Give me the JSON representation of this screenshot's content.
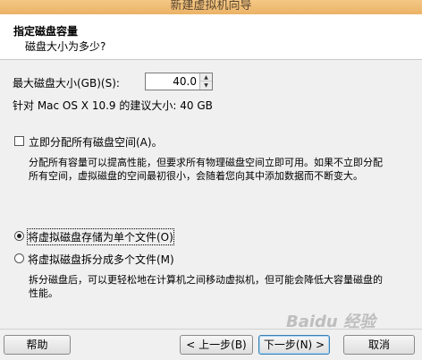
{
  "window": {
    "title": "新建虚拟机向导"
  },
  "header": {
    "title": "指定磁盘容量",
    "subtitle": "磁盘大小为多少?"
  },
  "disk_size": {
    "label": "最大磁盘大小(GB)(S):",
    "value": "40.0",
    "recommendation": "针对 Mac OS X 10.9 的建议大小: 40 GB"
  },
  "allocate": {
    "checked": false,
    "label": "立即分配所有磁盘空间(A)。",
    "description_line1": "分配所有容量可以提高性能，但要求所有物理磁盘空间立即可用。如果不立即分配",
    "description_line2": "所有空间，虚拟磁盘的空间最初很小，会随着您向其中添加数据而不断变大。"
  },
  "storage_options": {
    "single": {
      "label": "将虚拟磁盘存储为单个文件(O)",
      "selected": true
    },
    "multiple": {
      "label": "将虚拟磁盘拆分成多个文件(M)",
      "selected": false,
      "description_line1": "拆分磁盘后，可以更轻松地在计算机之间移动虚拟机，但可能会降低大容量磁盘的",
      "description_line2": "性能。"
    }
  },
  "buttons": {
    "help": "帮助",
    "back": "< 上一步(B)",
    "next": "下一步(N) >",
    "cancel": "取消"
  },
  "watermark": "Baidu 经验"
}
